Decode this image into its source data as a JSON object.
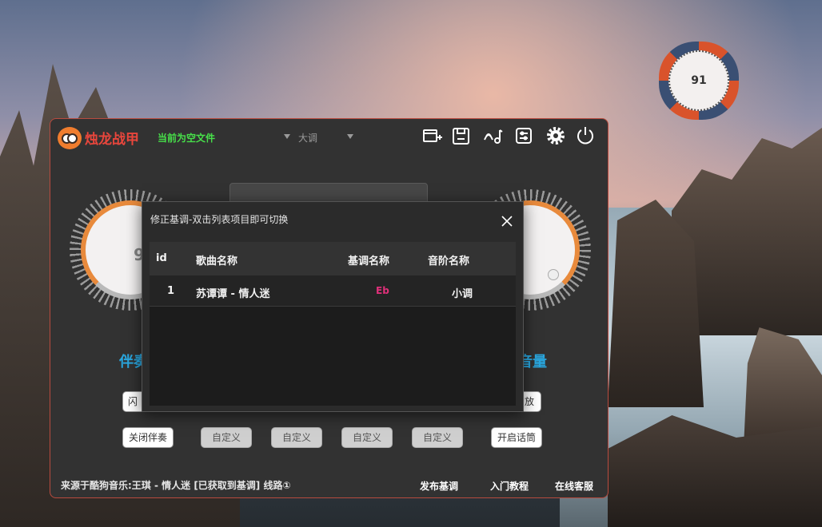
{
  "badge": {
    "value": "91"
  },
  "app": {
    "title": "烛龙战甲",
    "file_status": "当前为空文件",
    "key_mode": "大调",
    "colors": {
      "title": "#e9463c",
      "status": "#47e04a",
      "accent": "#2aa7df",
      "border": "#b84b3f"
    }
  },
  "toolbar": {
    "icons": [
      "new-file-icon",
      "save-file-icon",
      "music-note-icon",
      "tuner-icon",
      "settings-gear-icon",
      "power-icon"
    ]
  },
  "knobs": {
    "left": {
      "label": "伴奏",
      "value": "9"
    },
    "right": {
      "label": "音量"
    }
  },
  "buttons": {
    "left_partial": "闪",
    "right_partial": "放",
    "close_accompaniment": "关闭伴奏",
    "custom_1": "自定义",
    "custom_2": "自定义",
    "custom_3": "自定义",
    "custom_4": "自定义",
    "open_mic": "开启话筒"
  },
  "footer": {
    "source": "来源于酷狗音乐:王琪 - 情人迷 [已获取到基调] 线路①",
    "publish": "发布基调",
    "tutorial": "入门教程",
    "support": "在线客服"
  },
  "modal": {
    "title": "修正基调-双击列表项目即可切换",
    "columns": {
      "id": "id",
      "song": "歌曲名称",
      "key": "基调名称",
      "scale": "音阶名称"
    },
    "rows": [
      {
        "id": "1",
        "song": "苏谭谭 - 情人迷",
        "key": "Eb",
        "scale": "小调"
      }
    ]
  }
}
